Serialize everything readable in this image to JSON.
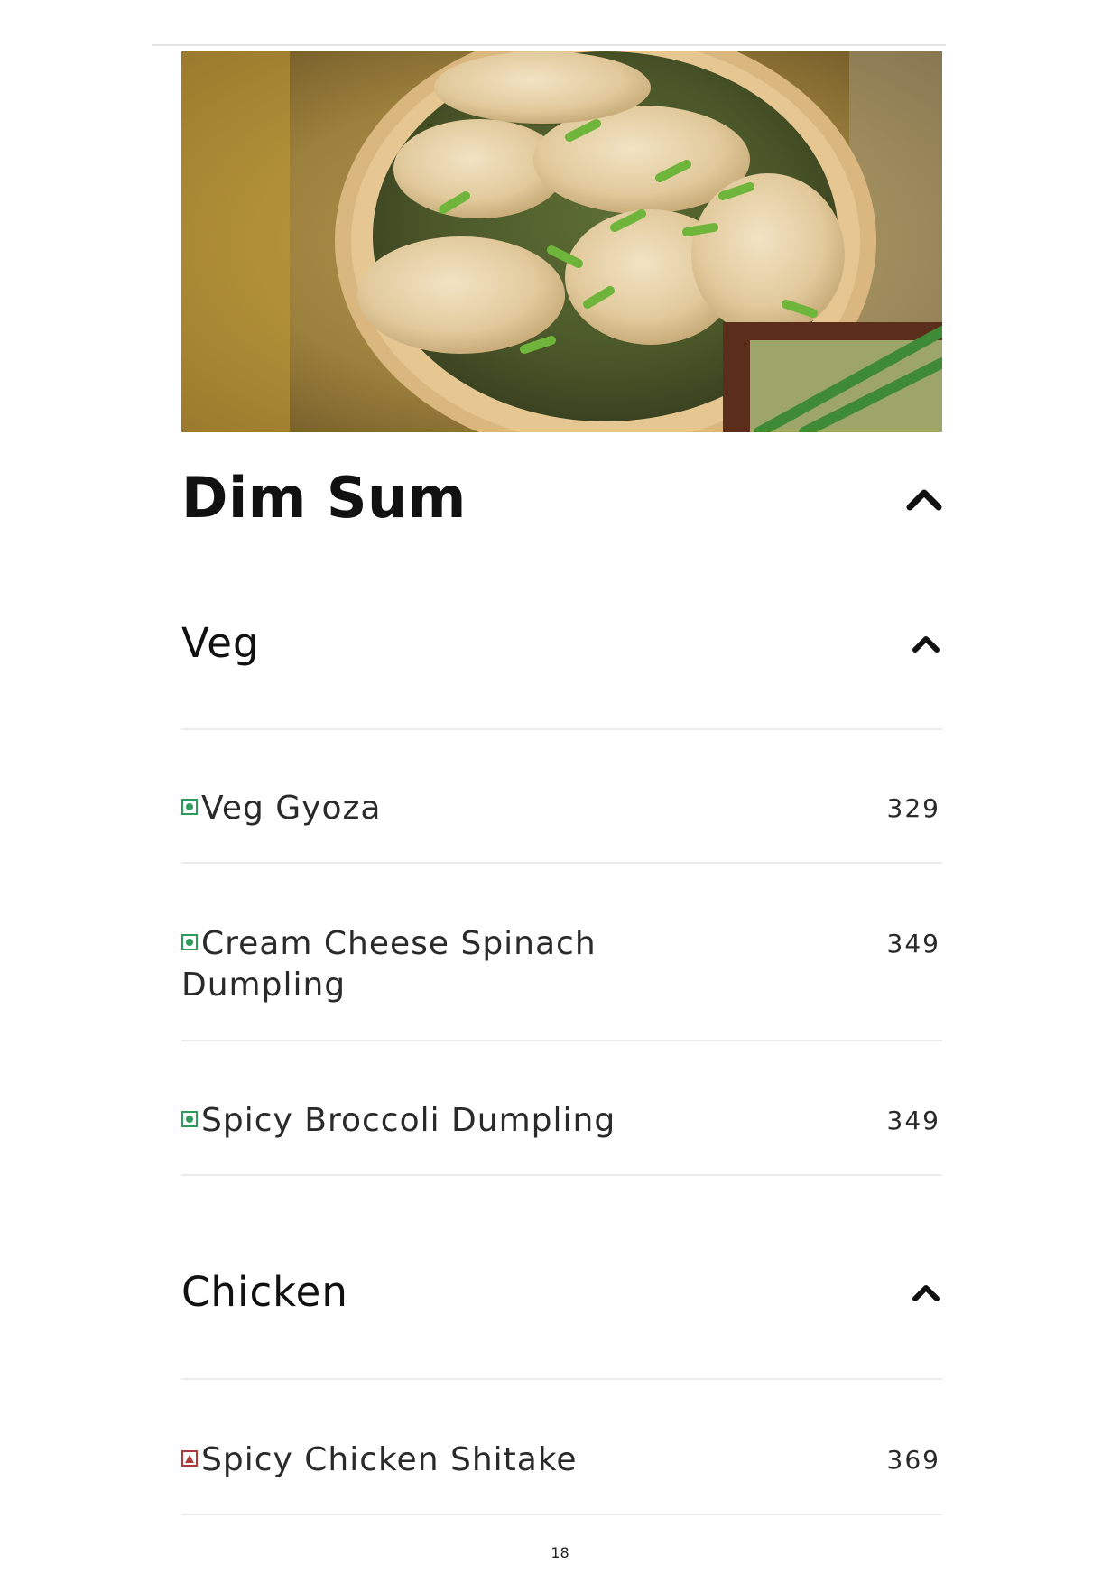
{
  "category": {
    "title": "Dim Sum",
    "image_alt": "dumplings in bamboo steamer"
  },
  "sections": [
    {
      "title": "Veg",
      "items": [
        {
          "name": "Veg Gyoza",
          "price": "329",
          "diet": "veg"
        },
        {
          "name": "Cream Cheese Spinach Dumpling",
          "price": "349",
          "diet": "veg"
        },
        {
          "name": "Spicy Broccoli Dumpling",
          "price": "349",
          "diet": "veg"
        }
      ]
    },
    {
      "title": "Chicken",
      "items": [
        {
          "name": "Spicy Chicken Shitake",
          "price": "369",
          "diet": "non-veg"
        }
      ]
    }
  ],
  "icons": {
    "collapse": "chevron-up-icon",
    "veg_marker": "veg-icon",
    "nonveg_marker": "non-veg-icon"
  },
  "colors": {
    "veg": "#2e9b5b",
    "non_veg": "#b03a3a"
  },
  "footer": {
    "page_number": "18"
  }
}
